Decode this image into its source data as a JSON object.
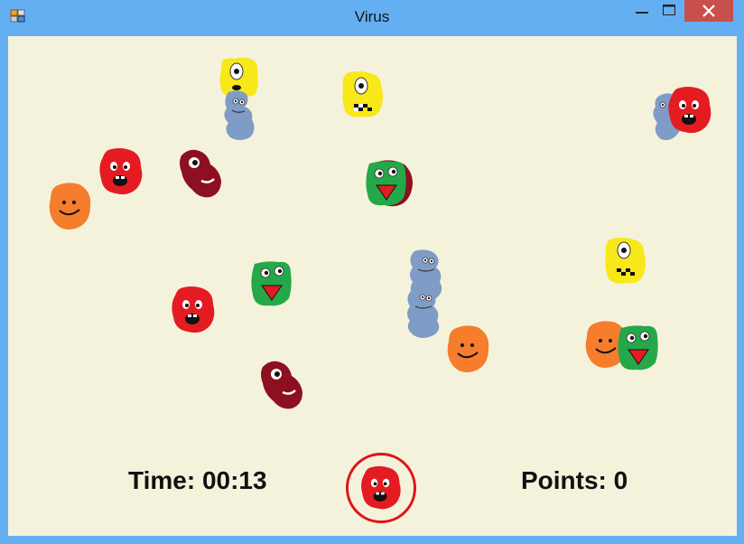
{
  "window": {
    "title": "Virus",
    "icons": {
      "app": "app-icon",
      "minimize": "minimize-icon",
      "maximize": "maximize-icon",
      "close": "close-icon"
    },
    "colors": {
      "frame": "#64aff2",
      "client_bg": "#f5f2dc",
      "close_button": "#c7504c"
    }
  },
  "hud": {
    "time_text": "Time: 00:13",
    "points_text": "Points: 0",
    "target_icon": "red-virus-icon",
    "target_ring_color": "#e0141a"
  },
  "virus_colors": {
    "red": "#e41c22",
    "orange": "#f57d2c",
    "green": "#24a84a",
    "yellow": "#f8e81a",
    "blue": "#7e9cc6",
    "maroon": "#8c1020"
  }
}
